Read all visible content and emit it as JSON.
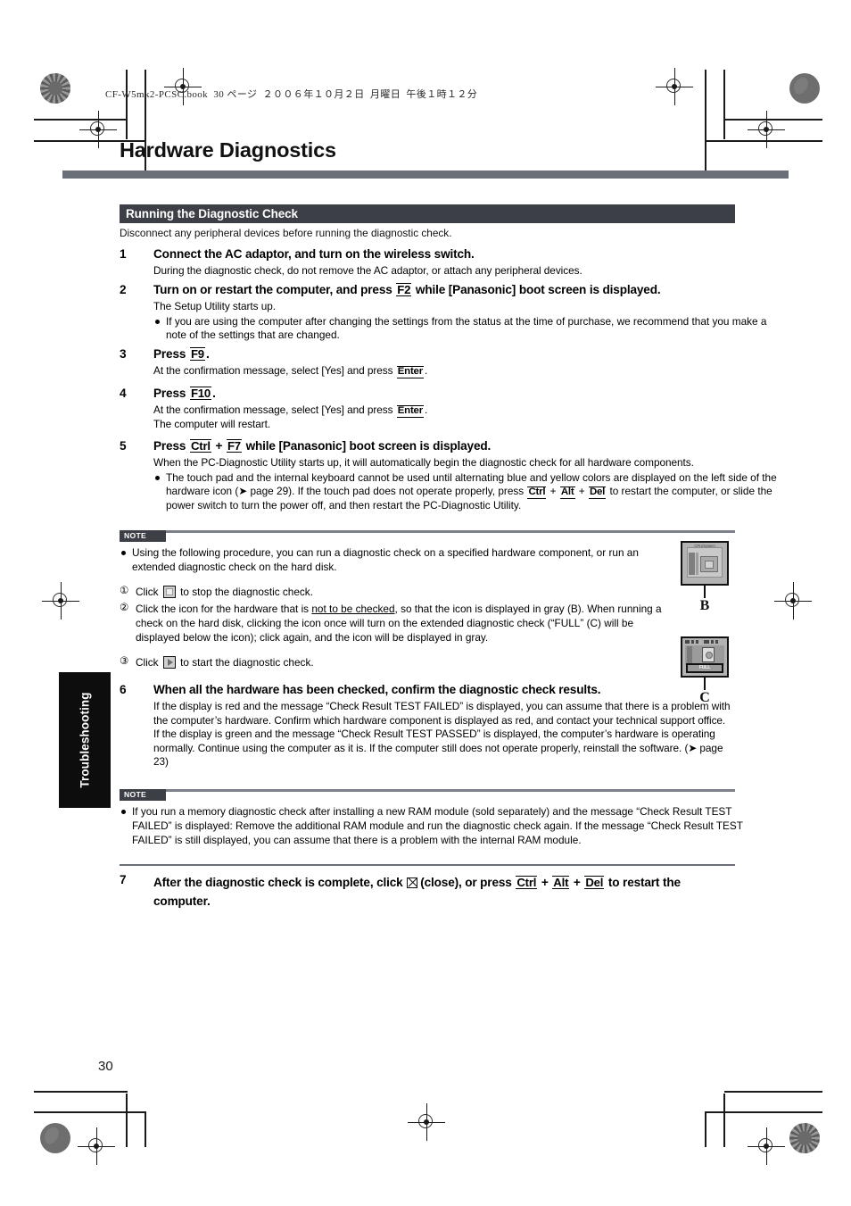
{
  "print_header": "CF-W5mk2-PCSC.book  30 ページ  ２００６年１０月２日  月曜日  午後１時１２分",
  "page_title": "Hardware Diagnostics",
  "page_number": "30",
  "side_tab": "Troubleshooting",
  "section": {
    "heading": "Running the Diagnostic Check",
    "lead": "Disconnect any peripheral devices before running the diagnostic check."
  },
  "steps": {
    "s1": {
      "num": "1",
      "heading": "Connect the AC adaptor, and turn on the wireless switch.",
      "text": "During the diagnostic check, do not remove the AC adaptor, or attach any peripheral devices."
    },
    "s2": {
      "num": "2",
      "head_a": "Turn on or restart the computer, and press",
      "key": "F2",
      "head_b": "while [Panasonic] boot screen is displayed.",
      "text": "The Setup Utility starts up.",
      "bullet": "If you are using the computer after changing the settings from the status at the time of purchase, we recommend that you make a note of the settings that are changed."
    },
    "s3": {
      "num": "3",
      "head_a": "Press",
      "key": "F9",
      "head_b": ".",
      "text_a": "At the confirmation message, select [Yes] and press",
      "key2": "Enter",
      "text_b": "."
    },
    "s4": {
      "num": "4",
      "head_a": "Press",
      "key": "F10",
      "head_b": ".",
      "text_a": "At the confirmation message, select [Yes] and press",
      "key2": "Enter",
      "text_b": ".",
      "text_c": "The computer will restart."
    },
    "s5": {
      "num": "5",
      "head_a": "Press",
      "key1": "Ctrl",
      "head_plus": "+",
      "key2": "F7",
      "head_b": "while [Panasonic] boot screen is displayed.",
      "text": "When the PC-Diagnostic Utility starts up, it will automatically begin the diagnostic check for all hardware components.",
      "bullet_a": "The touch pad and the internal keyboard cannot be used until alternating blue and yellow colors are displayed on the left side of the hardware icon (",
      "bullet_page_ref": "page 29",
      "bullet_b": "). If the touch pad does not operate properly, press",
      "bkey1": "Ctrl",
      "bkey2": "Alt",
      "bkey3": "Del",
      "bullet_c": "to restart the computer, or slide the power switch to turn the power off, and then restart the PC-Diagnostic Utility."
    },
    "s6": {
      "num": "6",
      "heading": "When all the hardware has been checked, confirm the diagnostic check results.",
      "para1": "If the display is red and the message “Check Result TEST FAILED” is displayed, you can assume that there is a problem with the computer’s hardware. Confirm which hardware component is displayed as red, and contact your technical support office.",
      "para2_a": "If the display is green and the message “Check Result TEST PASSED” is displayed, the computer’s hardware is operating normally. Continue using the computer as it is. If the computer still does not operate properly, reinstall the software. (",
      "para2_ref": "page 23",
      "para2_b": ")"
    },
    "s7": {
      "num": "7",
      "head_a": "After the diagnostic check is complete, click",
      "head_b": "(close), or press",
      "key1": "Ctrl",
      "key2": "Alt",
      "key3": "Del",
      "head_c": "to restart the computer."
    }
  },
  "note1": {
    "tag": "NOTE",
    "bullet": "Using the following procedure, you can run a diagnostic check on a specified hardware component, or run an extended diagnostic check on the hard disk.",
    "item1_num": "①",
    "item1_a": "Click",
    "item1_b": "to stop the diagnostic check.",
    "item2_num": "②",
    "item2_a": "Click the icon for the hardware that is",
    "item2_u": "not to be checked",
    "item2_b": ", so that the icon is displayed in gray (B). When running a check on the hard disk, clicking the icon once will turn on the extended diagnostic check (“FULL” (C) will be displayed below the icon); click again, and the icon will be displayed in gray.",
    "item3_num": "③",
    "item3_a": "Click",
    "item3_b": "to start the diagnostic check."
  },
  "note2": {
    "tag": "NOTE",
    "bullet": "If you run a memory diagnostic check after installing a new RAM module (sold separately) and the message “Check Result TEST FAILED” is displayed: Remove the additional RAM module and run the diagnostic check again. If the message “Check Result TEST FAILED” is still displayed, you can assume that there is a problem with the internal RAM module."
  },
  "figures": {
    "b_label": "B",
    "b_caption": "CPU/System",
    "c_label": "C",
    "c_badge": "FULL"
  },
  "colors": {
    "rule": "#6b7078",
    "section_bar": "#3c3f45",
    "tab": "#0d0d0d"
  }
}
